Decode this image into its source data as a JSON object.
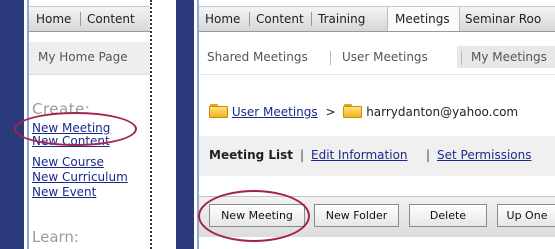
{
  "left": {
    "tabs": {
      "home": "Home",
      "content": "Content"
    },
    "sub_link": "My Home Page",
    "create_heading": "Create:",
    "create_links": [
      "New Meeting",
      "New Content",
      "New Course",
      "New Curriculum",
      "New Event"
    ],
    "learn_heading": "Learn:"
  },
  "right": {
    "tabs": [
      "Home",
      "Content",
      "Training",
      "Meetings",
      "Seminar Roo"
    ],
    "active_tab": "Meetings",
    "subnav": [
      "Shared Meetings",
      "User Meetings",
      "My Meetings"
    ],
    "subnav_selected": "My Meetings",
    "breadcrumb": {
      "link": "User Meetings",
      "separator": ">",
      "current": "harrydanton@yahoo.com"
    },
    "meeting_tabs": {
      "current": "Meeting List",
      "links": [
        "Edit Information",
        "Set Permissions"
      ],
      "separator": "|"
    },
    "toolbar": {
      "buttons": [
        "New Meeting",
        "New Folder",
        "Delete",
        "Up One"
      ]
    }
  },
  "colors": {
    "navy": "#2a3a7a",
    "link": "#1b2a8a",
    "highlight_circle": "#a3244a"
  }
}
